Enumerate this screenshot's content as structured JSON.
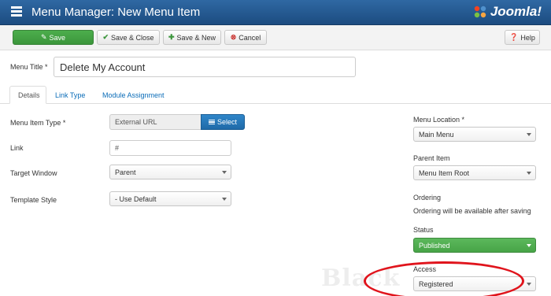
{
  "header": {
    "title": "Menu Manager: New Menu Item",
    "logo_text": "Joomla!"
  },
  "toolbar": {
    "save_label": "Save",
    "save_close_label": "Save & Close",
    "save_new_label": "Save & New",
    "cancel_label": "Cancel",
    "help_label": "Help"
  },
  "menu_title": {
    "label": "Menu Title *",
    "value": "Delete My Account"
  },
  "tabs": [
    {
      "label": "Details"
    },
    {
      "label": "Link Type"
    },
    {
      "label": "Module Assignment"
    }
  ],
  "form": {
    "menu_item_type": {
      "label": "Menu Item Type *",
      "value": "External URL",
      "button": "Select"
    },
    "link": {
      "label": "Link",
      "value": "#"
    },
    "target_window": {
      "label": "Target Window",
      "value": "Parent"
    },
    "template_style": {
      "label": "Template Style",
      "value": "- Use Default"
    }
  },
  "sidebar": {
    "menu_location": {
      "label": "Menu Location *",
      "value": "Main Menu"
    },
    "parent_item": {
      "label": "Parent Item",
      "value": "Menu Item Root"
    },
    "ordering": {
      "label": "Ordering",
      "note": "Ordering will be available after saving"
    },
    "status": {
      "label": "Status",
      "value": "Published"
    },
    "access": {
      "label": "Access",
      "value": "Registered"
    }
  },
  "watermark": "Black",
  "colors": {
    "header": "#2a5f97",
    "save_green": "#47a447",
    "select_blue": "#2a7bbf",
    "highlight_red": "#e0141c"
  }
}
